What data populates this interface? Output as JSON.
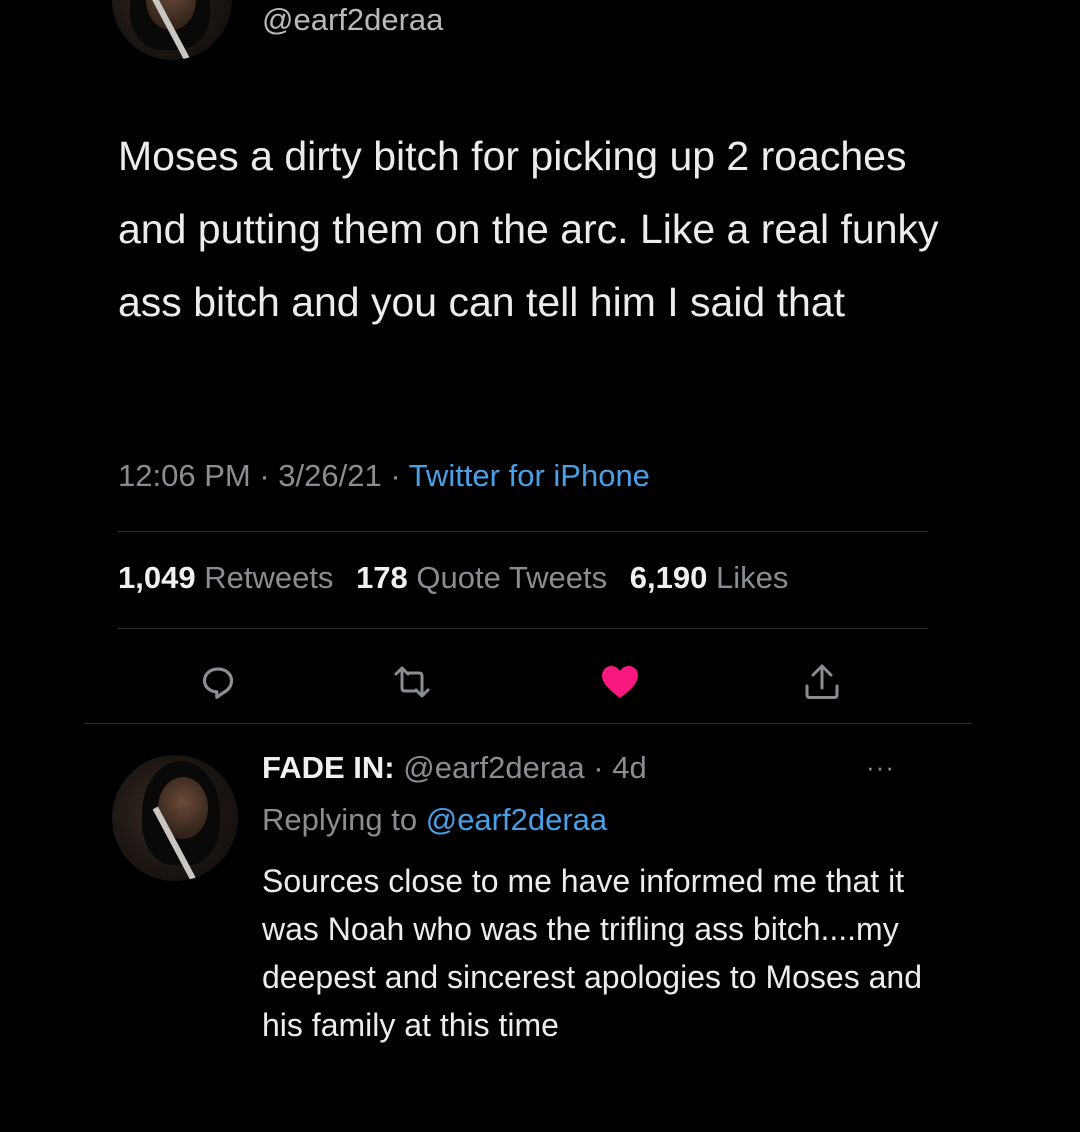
{
  "tweet": {
    "handle": "@earf2deraa",
    "text": "Moses a dirty bitch for picking up 2 roaches and putting them on the arc. Like a real funky ass bitch and you can tell him I said that",
    "time": "12:06 PM",
    "sep1": " · ",
    "date": "3/26/21",
    "sep2": " · ",
    "source": "Twitter for iPhone",
    "stats": {
      "retweets_count": "1,049",
      "retweets_label": "Retweets",
      "quotes_count": "178",
      "quotes_label": "Quote Tweets",
      "likes_count": "6,190",
      "likes_label": "Likes"
    },
    "actions": {
      "reply_icon": "reply-icon",
      "retweet_icon": "retweet-icon",
      "like_icon": "heart-icon",
      "share_icon": "share-icon",
      "liked": true,
      "like_color": "#f91880",
      "icon_color": "#8a8d91"
    }
  },
  "reply": {
    "display_name": "FADE IN:",
    "handle": "@earf2deraa",
    "dot": " · ",
    "age": "4d",
    "replying_label": "Replying to",
    "replying_to": "@earf2deraa",
    "text": "Sources close to me have informed me that it was Noah who was the trifling ass bitch....my deepest and sincerest apologies to Moses and his family at this time",
    "more_icon": "more-icon",
    "more_glyph": "···"
  },
  "colors": {
    "background": "#000000",
    "link": "#4aa0e6",
    "muted": "#8a8d91"
  }
}
